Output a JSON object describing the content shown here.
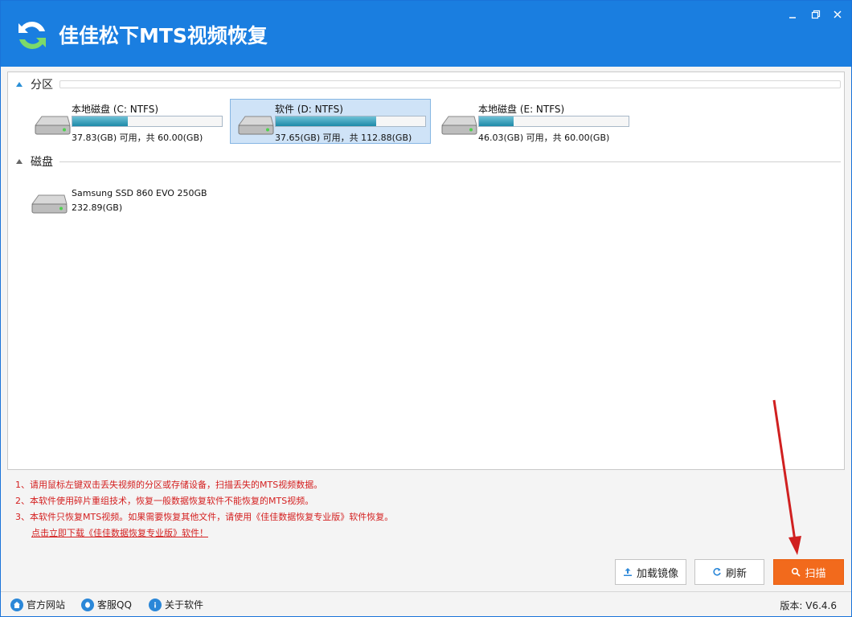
{
  "app": {
    "title": "佳佳松下MTS视频恢复"
  },
  "partitions": {
    "heading": "分区",
    "items": [
      {
        "name": "本地磁盘 (C: NTFS)",
        "info": "37.83(GB) 可用，共 60.00(GB)",
        "used_fraction": 0.37,
        "selected": false
      },
      {
        "name": "软件 (D: NTFS)",
        "info": "37.65(GB) 可用，共 112.88(GB)",
        "used_fraction": 0.67,
        "selected": true
      },
      {
        "name": "本地磁盘 (E: NTFS)",
        "info": "46.03(GB) 可用，共 60.00(GB)",
        "used_fraction": 0.23,
        "selected": false
      }
    ]
  },
  "disks": {
    "heading": "磁盘",
    "items": [
      {
        "name": "Samsung SSD 860 EVO 250GB",
        "info": "232.89(GB)"
      }
    ]
  },
  "notes": {
    "line1": "1、请用鼠标左键双击丢失视频的分区或存储设备，扫描丢失的MTS视频数据。",
    "line2": "2、本软件使用碎片重组技术，恢复一般数据恢复软件不能恢复的MTS视频。",
    "line3": "3、本软件只恢复MTS视频。如果需要恢复其他文件，请使用《佳佳数据恢复专业版》软件恢复。",
    "link": "点击立即下载《佳佳数据恢复专业版》软件！"
  },
  "buttons": {
    "load_image": "加载镜像",
    "refresh": "刷新",
    "scan": "扫描"
  },
  "statusbar": {
    "website": "官方网站",
    "qq": "客服QQ",
    "about": "关于软件",
    "version": "版本: V6.4.6"
  },
  "colors": {
    "titlebar": "#1a7ee0",
    "accent": "#2b87d8",
    "scan_button": "#f26a1c",
    "note_text": "#d42020",
    "selection": "#cfe3f7"
  }
}
